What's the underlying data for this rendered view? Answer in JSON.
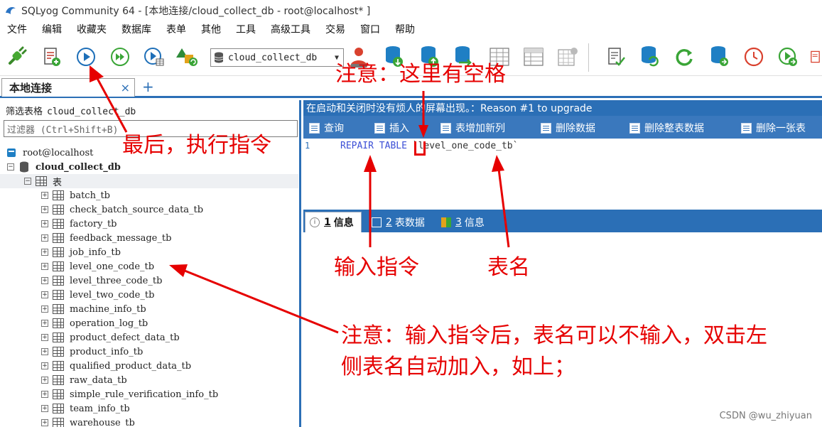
{
  "window": {
    "title": "SQLyog Community 64 - [本地连接/cloud_collect_db - root@localhost* ]"
  },
  "menu": [
    "文件",
    "编辑",
    "收藏夹",
    "数据库",
    "表单",
    "其他",
    "工具",
    "高级工具",
    "交易",
    "窗口",
    "帮助"
  ],
  "toolbar": {
    "database_selected": "cloud_collect_db"
  },
  "connection_tab": {
    "label": "本地连接",
    "close": "×",
    "add": "+"
  },
  "left_panel": {
    "filter_label": "筛选表格",
    "filter_db": "cloud_collect_db",
    "filter_placeholder": "过滤器 (Ctrl+Shift+B)",
    "root": "root@localhost",
    "database": "cloud_collect_db",
    "tables_folder": "表",
    "tables": [
      "batch_tb",
      "check_batch_source_data_tb",
      "factory_tb",
      "feedback_message_tb",
      "job_info_tb",
      "level_one_code_tb",
      "level_three_code_tb",
      "level_two_code_tb",
      "machine_info_tb",
      "operation_log_tb",
      "product_defect_data_tb",
      "product_info_tb",
      "qualified_product_data_tb",
      "raw_data_tb",
      "simple_rule_verification_info_tb",
      "team_info_tb",
      "warehouse_tb"
    ]
  },
  "right_panel": {
    "banner": "在启动和关闭时没有烦人的屏幕出现。：Reason #1 to upgrade",
    "query_buttons": [
      "查询",
      "插入",
      "表增加新列",
      "删除数据",
      "删除整表数据",
      "删除一张表"
    ],
    "editor": {
      "line": "1",
      "keyword": "REPAIR TABLE",
      "table_name": "`level_one_code_tb`"
    },
    "result_tabs": [
      {
        "num": "1",
        "label": "信息"
      },
      {
        "num": "2",
        "label": "表数据"
      },
      {
        "num": "3",
        "label": "信息"
      }
    ]
  },
  "annotations": {
    "space_note": "注意：这里有空格",
    "execute_note": "最后，执行指令",
    "input_cmd": "输入指令",
    "table_name": "表名",
    "double_click_note_line1": "注意：输入指令后，表名可以不输入，双击左",
    "double_click_note_line2": "侧表名自动加入，如上；"
  },
  "watermark": "CSDN @wu_zhiyuan"
}
